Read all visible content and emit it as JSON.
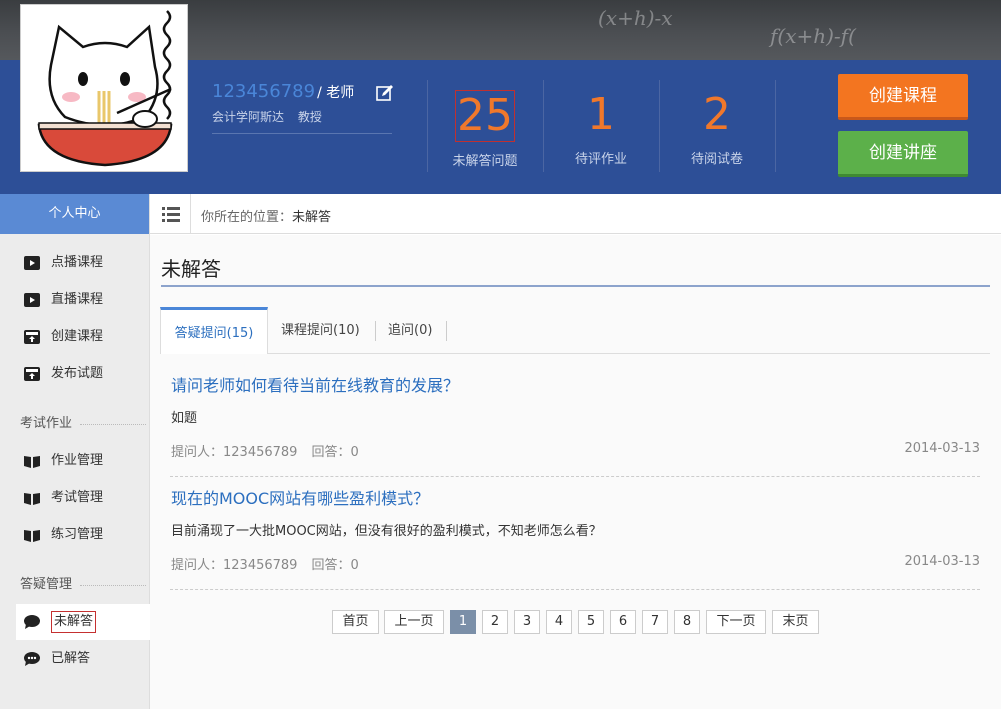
{
  "chalkboard": {
    "math1": "(x+h)-x",
    "math2": "f(x+h)-f("
  },
  "user": {
    "name": "123456789",
    "role": "/ 老师",
    "school": "会计学阿斯达",
    "title": "教授"
  },
  "stats": [
    {
      "value": "25",
      "label": "未解答问题"
    },
    {
      "value": "1",
      "label": "待评作业"
    },
    {
      "value": "2",
      "label": "待阅试卷"
    }
  ],
  "actions": {
    "create_course": "创建课程",
    "create_lecture": "创建讲座"
  },
  "sidebar": {
    "header": "个人中心",
    "items": [
      {
        "label": "点播课程",
        "icon": "video-icon"
      },
      {
        "label": "直播课程",
        "icon": "video-icon"
      },
      {
        "label": "创建课程",
        "icon": "upload-box-icon"
      },
      {
        "label": "发布试题",
        "icon": "upload-box-icon"
      }
    ],
    "group_exam": "考试作业",
    "exam_items": [
      {
        "label": "作业管理",
        "icon": "book-icon"
      },
      {
        "label": "考试管理",
        "icon": "book-icon"
      },
      {
        "label": "练习管理",
        "icon": "book-icon"
      }
    ],
    "group_qa": "答疑管理",
    "qa_items": [
      {
        "label": "未解答",
        "icon": "comment-icon"
      },
      {
        "label": "已解答",
        "icon": "comments-icon"
      }
    ]
  },
  "breadcrumb": {
    "prefix": "你所在的位置：",
    "current": "未解答"
  },
  "page": {
    "title": "未解答"
  },
  "tabs": [
    {
      "label": "答疑提问(15)"
    },
    {
      "label": "课程提问(10)"
    },
    {
      "label": "追问(0)"
    }
  ],
  "questions": [
    {
      "title": "请问老师如何看待当前在线教育的发展？",
      "body": "如题",
      "asker": "提问人：123456789",
      "answers": "回答：0",
      "date": "2014-03-13"
    },
    {
      "title": "现在的MOOC网站有哪些盈利模式？",
      "body": "目前涌现了一大批MOOC网站，但没有很好的盈利模式，不知老师怎么看？",
      "asker": "提问人：123456789",
      "answers": "回答：0",
      "date": "2014-03-13"
    }
  ],
  "pagination": {
    "first": "首页",
    "prev": "上一页",
    "pages": [
      "1",
      "2",
      "3",
      "4",
      "5",
      "6",
      "7",
      "8"
    ],
    "current": "1",
    "next": "下一页",
    "last": "末页"
  }
}
